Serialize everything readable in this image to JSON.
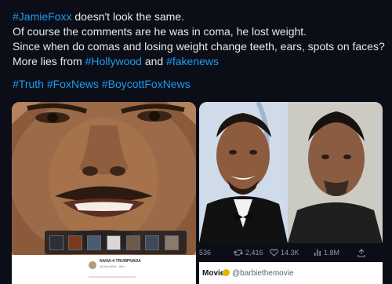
{
  "tweet": {
    "line1_tag": "#JamieFoxx",
    "line1_rest": " doesn't look the same.",
    "line2": "Of course the comments are he was in coma, he lost weight.",
    "line3": "Since when do comas and losing weight change teeth, ears, spots on faces?",
    "line4_start": "More lies from ",
    "line4_tag1": "#Hollywood",
    "line4_mid": " and ",
    "line4_tag2": "#fakenews",
    "hashtags": [
      "#Truth",
      "#FoxNews",
      "#BoycottFoxNews"
    ]
  },
  "left_media": {
    "footer_name": "NANA-4-TRUMPNADA",
    "footer_handle": "@GinnaBell · 88m"
  },
  "right_media": {
    "actions": {
      "replies": "536",
      "retweets": "2,416",
      "likes": "14.3K",
      "views": "1.8M"
    },
    "quoted_name": "Movie",
    "quoted_handle": "@barbiethemovie"
  },
  "colors": {
    "background": "#0c0e17",
    "text": "#e7e9ea",
    "link": "#1d9bf0"
  },
  "icons": [
    "retweet-icon",
    "heart-icon",
    "views-icon",
    "share-icon",
    "verified-badge-icon"
  ]
}
